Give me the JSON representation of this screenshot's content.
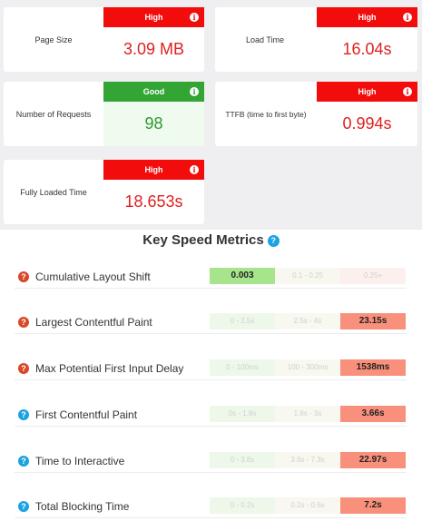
{
  "cards": [
    {
      "label": "Page Size",
      "badge": "High",
      "value": "3.09 MB"
    },
    {
      "label": "Load Time",
      "badge": "High",
      "value": "16.04s"
    },
    {
      "label": "Number of Requests",
      "badge": "Good",
      "value": "98"
    },
    {
      "label": "TTFB (time to first byte)",
      "badge": "High",
      "value": "0.994s"
    },
    {
      "label": "Fully Loaded Time",
      "badge": "High",
      "value": "18.653s"
    }
  ],
  "info_icon": "i",
  "metrics": {
    "title": "Key Speed Metrics",
    "help_icon": "?",
    "rows": [
      {
        "name": "Cumulative Layout Shift",
        "s1": "0.003",
        "s2": "0.1 - 0.25",
        "s3": "0.25+"
      },
      {
        "name": "Largest Contentful Paint",
        "s1": "0 - 2.5s",
        "s2": "2.5s - 4s",
        "s3": "23.15s"
      },
      {
        "name": "Max Potential First Input Delay",
        "s1": "0 - 100ms",
        "s2": "100 - 300ms",
        "s3": "1538ms"
      },
      {
        "name": "First Contentful Paint",
        "s1": "0s - 1.8s",
        "s2": "1.8s - 3s",
        "s3": "3.66s"
      },
      {
        "name": "Time to Interactive",
        "s1": "0 - 3.8s",
        "s2": "3.8s - 7.3s",
        "s3": "22.97s"
      },
      {
        "name": "Total Blocking Time",
        "s1": "0 - 0.2s",
        "s2": "0.2s - 0.6s",
        "s3": "7.2s"
      }
    ]
  },
  "colors": {
    "high": "#f20c0c",
    "good": "#33a535",
    "metric_active_good": "#a7e58c",
    "metric_active_bad": "#f9907c",
    "help_blue": "#1aa3e0",
    "help_red": "#d9472b"
  }
}
